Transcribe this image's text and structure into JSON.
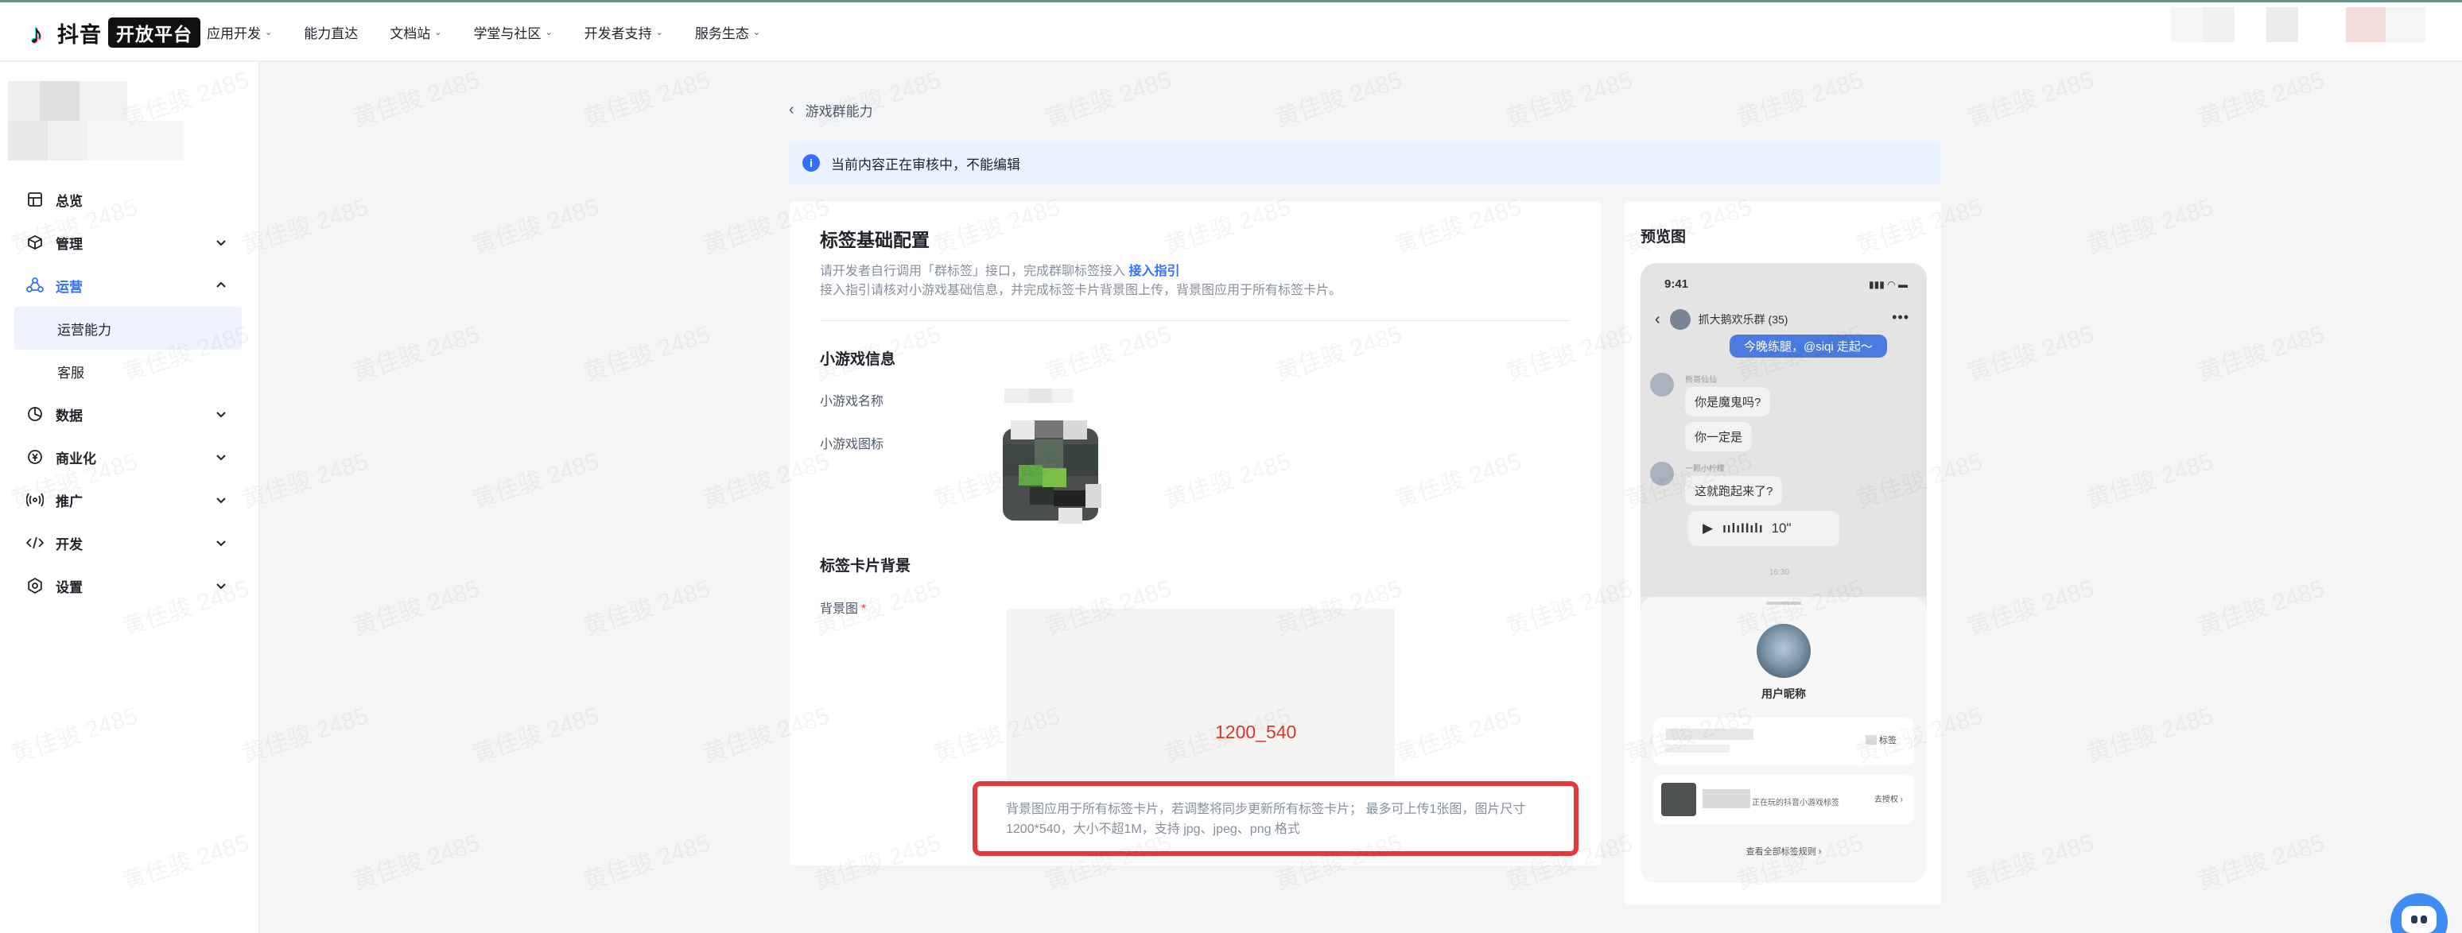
{
  "brand": {
    "name": "抖音",
    "badge": "开放平台"
  },
  "nav": [
    {
      "label": "应用开发",
      "dropdown": true
    },
    {
      "label": "能力直达",
      "dropdown": false
    },
    {
      "label": "文档站",
      "dropdown": true
    },
    {
      "label": "学堂与社区",
      "dropdown": true
    },
    {
      "label": "开发者支持",
      "dropdown": true
    },
    {
      "label": "服务生态",
      "dropdown": true
    }
  ],
  "sidebar": {
    "items": [
      {
        "label": "总览",
        "icon": "dashboard-icon",
        "expandable": false
      },
      {
        "label": "管理",
        "icon": "box-icon",
        "expandable": true
      },
      {
        "label": "运营",
        "icon": "operations-icon",
        "expandable": true,
        "expanded": true,
        "children": [
          {
            "label": "运营能力",
            "active": true
          },
          {
            "label": "客服",
            "active": false
          }
        ]
      },
      {
        "label": "数据",
        "icon": "pie-chart-icon",
        "expandable": true
      },
      {
        "label": "商业化",
        "icon": "yuan-icon",
        "expandable": true
      },
      {
        "label": "推广",
        "icon": "broadcast-icon",
        "expandable": true
      },
      {
        "label": "开发",
        "icon": "code-icon",
        "expandable": true
      },
      {
        "label": "设置",
        "icon": "settings-icon",
        "expandable": true
      }
    ]
  },
  "breadcrumb": {
    "label": "游戏群能力"
  },
  "alert": {
    "text": "当前内容正在审核中，不能编辑"
  },
  "config": {
    "title": "标签基础配置",
    "desc1_prefix": "请开发者自行调用「群标签」接口，完成群聊标签接入",
    "desc1_link": "接入指引",
    "desc2": "接入指引请核对小游戏基础信息，并完成标签卡片背景图上传，背景图应用于所有标签卡片。",
    "game_info_title": "小游戏信息",
    "game_name_label": "小游戏名称",
    "game_icon_label": "小游戏图标",
    "card_bg_title": "标签卡片背景",
    "bg_label": "背景图",
    "bg_size_text": "1200_540",
    "hint": "背景图应用于所有标签卡片，若调整将同步更新所有标签卡片； 最多可上传1张图，图片尺寸1200*540，大小不超1M，支持 jpg、jpeg、png 格式"
  },
  "preview": {
    "title": "预览图",
    "status_time": "9:41",
    "chat_title": "抓大鹅欢乐群 (35)",
    "blue_bubble": "今晚练腿，@siqi 走起～",
    "sender1": "熊哥仙仙",
    "bubble1": "你是魔鬼吗?",
    "bubble2": "你一定是",
    "sender2": "一颗小柠檬",
    "bubble3": "这就跑起来了?",
    "voice_duration": "10\"",
    "timestamp": "16:30",
    "user_name": "用户昵称",
    "tag_label": "标签",
    "game_desc": "正在玩的抖音小游戏标签",
    "authorize": "去授权",
    "view_all": "查看全部标签规则"
  },
  "watermark": "黄佳骏 2485",
  "colors": {
    "accent": "#3370ff",
    "alert_bg": "#e8f3ff",
    "highlight_border": "#e23a3a",
    "size_text": "#d8372c"
  }
}
